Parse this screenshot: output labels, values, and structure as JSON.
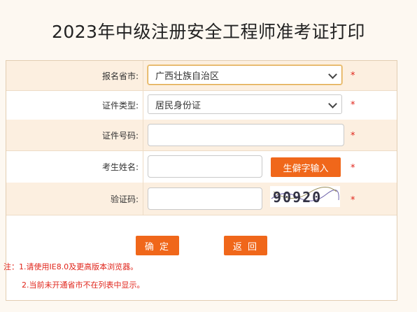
{
  "page": {
    "title": "2023年中级注册安全工程师准考证打印"
  },
  "form": {
    "province": {
      "label": "报名省市:",
      "selected": "广西壮族自治区"
    },
    "id_type": {
      "label": "证件类型:",
      "selected": "居民身份证"
    },
    "id_number": {
      "label": "证件号码:",
      "value": ""
    },
    "name": {
      "label": "考生姓名:",
      "value": "",
      "rare_char_button": "生僻字输入"
    },
    "captcha": {
      "label": "验证码:",
      "value": "",
      "image_text": "90920"
    },
    "required_mark": "*",
    "confirm_button": "确 定",
    "back_button": "返 回"
  },
  "notes": {
    "line1": "注：1.请使用IE8.0及更高版本浏览器。",
    "line2": "2.当前未开通省市不在列表中显示。"
  },
  "colors": {
    "accent": "#f0671a",
    "required": "#e0241a",
    "row_alt": "#fcefe0"
  }
}
